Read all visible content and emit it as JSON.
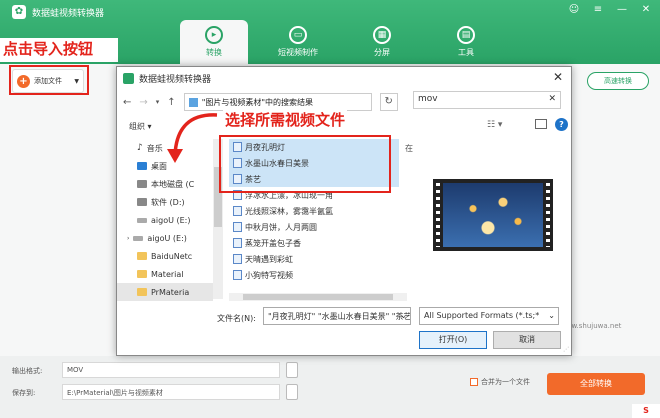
{
  "app": {
    "title": "数据蛙视频转换器",
    "window_controls": {
      "skin": "☺",
      "menu": "≡",
      "minimize": "—",
      "close": "✕"
    },
    "tabs": [
      {
        "label": "转换",
        "icon": "convert-icon",
        "active": true
      },
      {
        "label": "短视频制作",
        "icon": "short-video-icon",
        "active": false
      },
      {
        "label": "分屏",
        "icon": "split-screen-icon",
        "active": false
      },
      {
        "label": "工具",
        "icon": "toolbox-icon",
        "active": false
      }
    ],
    "toolbar": {
      "add_file_label": "添加文件",
      "hd_convert_label": "高速转换"
    },
    "bottom": {
      "output_format_label": "输出格式:",
      "output_format_value": "MOV",
      "save_to_label": "保存到:",
      "save_to_value": "E:\\PrMaterial\\图片与视频素材",
      "merge_label": "合并为一个文件",
      "convert_all_label": "全部转换"
    }
  },
  "annotations": {
    "click_import": "点击导入按钮",
    "select_files": "选择所需视频文件"
  },
  "dialog": {
    "title": "数据蛙视频转换器",
    "path_text": "\"图片与视频素材\"中的搜索结果",
    "search_value": "mov",
    "organize_label": "组织 ▾",
    "location_hint": "在",
    "tree": [
      {
        "label": "音乐",
        "icon": "music-icon",
        "level": 1
      },
      {
        "label": "桌面",
        "icon": "desktop-icon",
        "level": 1
      },
      {
        "label": "本地磁盘 (C",
        "icon": "disk-icon",
        "level": 1
      },
      {
        "label": "软件 (D:)",
        "icon": "disk-icon",
        "level": 1
      },
      {
        "label": "aigoU (E:)",
        "icon": "usb-drive-icon",
        "level": 1
      },
      {
        "label": "aigoU (E:)",
        "icon": "usb-drive-icon",
        "level": 0
      },
      {
        "label": "BaiduNetc",
        "icon": "folder-icon",
        "level": 1
      },
      {
        "label": "Material",
        "icon": "folder-icon",
        "level": 1
      },
      {
        "label": "PrMateria",
        "icon": "folder-icon",
        "level": 1,
        "selected": true
      }
    ],
    "files": [
      {
        "name": "月夜孔明灯",
        "selected": true
      },
      {
        "name": "水墨山水春日美景",
        "selected": true
      },
      {
        "name": "茶艺",
        "selected": true
      },
      {
        "name": "浮冰水上漂，冰山现一角",
        "selected": false
      },
      {
        "name": "光线照深林，雾霭半氤氲",
        "selected": false
      },
      {
        "name": "中秋月饼，人月两圆",
        "selected": false
      },
      {
        "name": "蒸笼开盖包子香",
        "selected": false
      },
      {
        "name": "天晴遇到彩虹",
        "selected": false
      },
      {
        "name": "小狗特写视频",
        "selected": false
      }
    ],
    "filename_label": "文件名(N):",
    "filename_value": "\"月夜孔明灯\" \"水墨山水春日美景\" \"茶艺\"",
    "filter_value": "All Supported Formats (*.ts;*",
    "open_label": "打开(O)",
    "cancel_label": "取消"
  },
  "watermark": "www.shujuwa.net",
  "corner_badge": "S",
  "colors": {
    "brand": "#2aa366",
    "accent": "#f26a2a",
    "annotation": "#e3241c"
  }
}
